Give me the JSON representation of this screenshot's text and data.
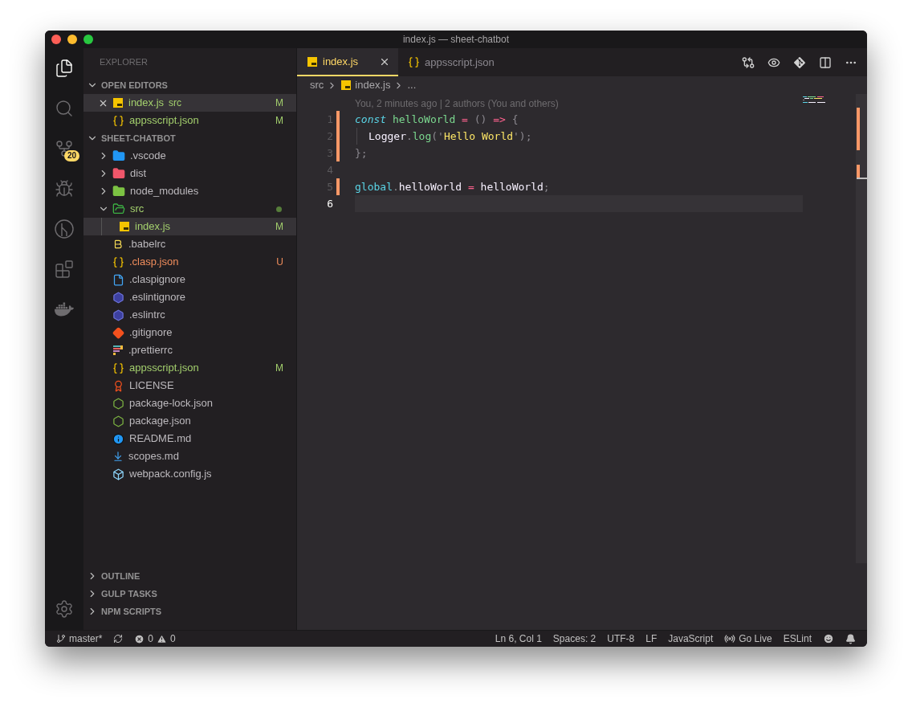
{
  "window": {
    "title": "index.js — sheet-chatbot"
  },
  "activity_bar": {
    "items": [
      {
        "kind": "explorer",
        "selected": true
      },
      {
        "kind": "search",
        "selected": false
      },
      {
        "kind": "scm",
        "selected": false,
        "badge": "20"
      },
      {
        "kind": "debug",
        "selected": false
      },
      {
        "kind": "gitlens",
        "selected": false
      },
      {
        "kind": "extensions",
        "selected": false
      },
      {
        "kind": "docker",
        "selected": false
      }
    ],
    "bottom": [
      {
        "kind": "settings"
      }
    ]
  },
  "sidebar": {
    "title": "EXPLORER",
    "sections": [
      {
        "title": "OPEN EDITORS",
        "expanded": true,
        "items": [
          {
            "label": "index.js",
            "detail": "src",
            "kind": "js",
            "modified": true,
            "untracked": false,
            "badge": "M",
            "selected": true
          },
          {
            "label": "appsscript.json",
            "kind": "json",
            "modified": true,
            "untracked": false,
            "badge": "M",
            "selected": false
          }
        ]
      },
      {
        "title": "SHEET-CHATBOT",
        "expanded": true,
        "items": [
          {
            "label": ".vscode",
            "kind": "vscodefolder",
            "expanded": false,
            "modified": false,
            "untracked": false,
            "selected": false
          },
          {
            "label": "dist",
            "kind": "distfolder",
            "expanded": false,
            "modified": false,
            "untracked": false,
            "selected": false
          },
          {
            "label": "node_modules",
            "kind": "nodefolder",
            "expanded": false,
            "modified": false,
            "untracked": false,
            "selected": false
          },
          {
            "label": "src",
            "kind": "srcfolder",
            "expanded": true,
            "modified": true,
            "untracked": false,
            "selected": false,
            "children": [
              {
                "label": "index.js",
                "kind": "js",
                "modified": true,
                "untracked": false,
                "badge": "M",
                "selected": true
              }
            ]
          },
          {
            "label": ".babelrc",
            "kind": "babel",
            "modified": false,
            "untracked": false,
            "selected": false
          },
          {
            "label": ".clasp.json",
            "kind": "json",
            "modified": false,
            "untracked": true,
            "badge": "U",
            "selected": false
          },
          {
            "label": ".claspignore",
            "kind": "file",
            "modified": false,
            "untracked": false,
            "selected": false
          },
          {
            "label": ".eslintignore",
            "kind": "eslint",
            "modified": false,
            "untracked": false,
            "selected": false
          },
          {
            "label": ".eslintrc",
            "kind": "eslint",
            "modified": false,
            "untracked": false,
            "selected": false
          },
          {
            "label": ".gitignore",
            "kind": "git",
            "modified": false,
            "untracked": false,
            "selected": false
          },
          {
            "label": ".prettierrc",
            "kind": "prettier",
            "modified": false,
            "untracked": false,
            "selected": false
          },
          {
            "label": "appsscript.json",
            "kind": "json",
            "modified": true,
            "untracked": false,
            "badge": "M",
            "selected": false
          },
          {
            "label": "LICENSE",
            "kind": "license",
            "modified": false,
            "untracked": false,
            "selected": false
          },
          {
            "label": "package-lock.json",
            "kind": "node",
            "modified": false,
            "untracked": false,
            "selected": false
          },
          {
            "label": "package.json",
            "kind": "node",
            "modified": false,
            "untracked": false,
            "selected": false
          },
          {
            "label": "README.md",
            "kind": "info",
            "modified": false,
            "untracked": false,
            "selected": false
          },
          {
            "label": "scopes.md",
            "kind": "markdown",
            "modified": false,
            "untracked": false,
            "selected": false
          },
          {
            "label": "webpack.config.js",
            "kind": "webpack",
            "modified": false,
            "untracked": false,
            "selected": false
          }
        ]
      },
      {
        "title": "OUTLINE",
        "expanded": false
      },
      {
        "title": "GULP TASKS",
        "expanded": false
      },
      {
        "title": "NPM SCRIPTS",
        "expanded": false
      }
    ]
  },
  "editor": {
    "tabs": [
      {
        "label": "index.js",
        "kind": "js",
        "selected": true
      },
      {
        "label": "appsscript.json",
        "kind": "json",
        "selected": false
      }
    ],
    "actions": [
      {
        "kind": "compare"
      },
      {
        "kind": "changes"
      },
      {
        "kind": "git"
      },
      {
        "kind": "split"
      },
      {
        "kind": "more"
      }
    ],
    "breadcrumb": [
      {
        "label": "src"
      },
      {
        "label": "index.js",
        "kind": "js"
      },
      {
        "label": "..."
      }
    ],
    "blame": "You, 2 minutes ago | 2 authors (You and others)",
    "lines": [
      {
        "number": "1",
        "changed": true,
        "current": false,
        "tokens": [
          {
            "text": "const",
            "kind": "keyword"
          },
          {
            "text": " helloWorld",
            "kind": "function"
          },
          {
            "text": " =",
            "kind": "operator"
          },
          {
            "text": " ()",
            "kind": "punct"
          },
          {
            "text": " =>",
            "kind": "operator"
          },
          {
            "text": " {",
            "kind": "punct"
          }
        ]
      },
      {
        "number": "2",
        "changed": true,
        "current": false,
        "indent_guide": true,
        "tokens": [
          {
            "text": "Logger",
            "kind": "plain"
          },
          {
            "text": ".",
            "kind": "punct"
          },
          {
            "text": "log",
            "kind": "function"
          },
          {
            "text": "('",
            "kind": "punct"
          },
          {
            "text": "Hello World",
            "kind": "string"
          },
          {
            "text": "');",
            "kind": "punct"
          }
        ]
      },
      {
        "number": "3",
        "changed": true,
        "current": false,
        "tokens": [
          {
            "text": "};",
            "kind": "punct"
          }
        ]
      },
      {
        "number": "4",
        "changed": false,
        "current": false
      },
      {
        "number": "5",
        "changed": true,
        "current": false,
        "tokens": [
          {
            "text": "global",
            "kind": "builtin"
          },
          {
            "text": ".",
            "kind": "punct"
          },
          {
            "text": "helloWorld",
            "kind": "plain"
          },
          {
            "text": " =",
            "kind": "operator"
          },
          {
            "text": " helloWorld",
            "kind": "plain"
          },
          {
            "text": ";",
            "kind": "punct"
          }
        ]
      },
      {
        "number": "6",
        "changed": false,
        "current": true
      }
    ]
  },
  "status_bar": {
    "left": [
      {
        "kind": "branch",
        "text": "master*"
      },
      {
        "kind": "sync"
      },
      {
        "kind": "problems",
        "errors": "0",
        "warnings": "0"
      }
    ],
    "right": [
      {
        "kind": "text",
        "text": "Ln 6, Col 1"
      },
      {
        "kind": "text",
        "text": "Spaces: 2"
      },
      {
        "kind": "text",
        "text": "UTF-8"
      },
      {
        "kind": "text",
        "text": "LF"
      },
      {
        "kind": "text",
        "text": "JavaScript"
      },
      {
        "kind": "golive",
        "text": "Go Live"
      },
      {
        "kind": "text",
        "text": "ESLint"
      },
      {
        "kind": "feedback"
      },
      {
        "kind": "bell"
      }
    ]
  }
}
